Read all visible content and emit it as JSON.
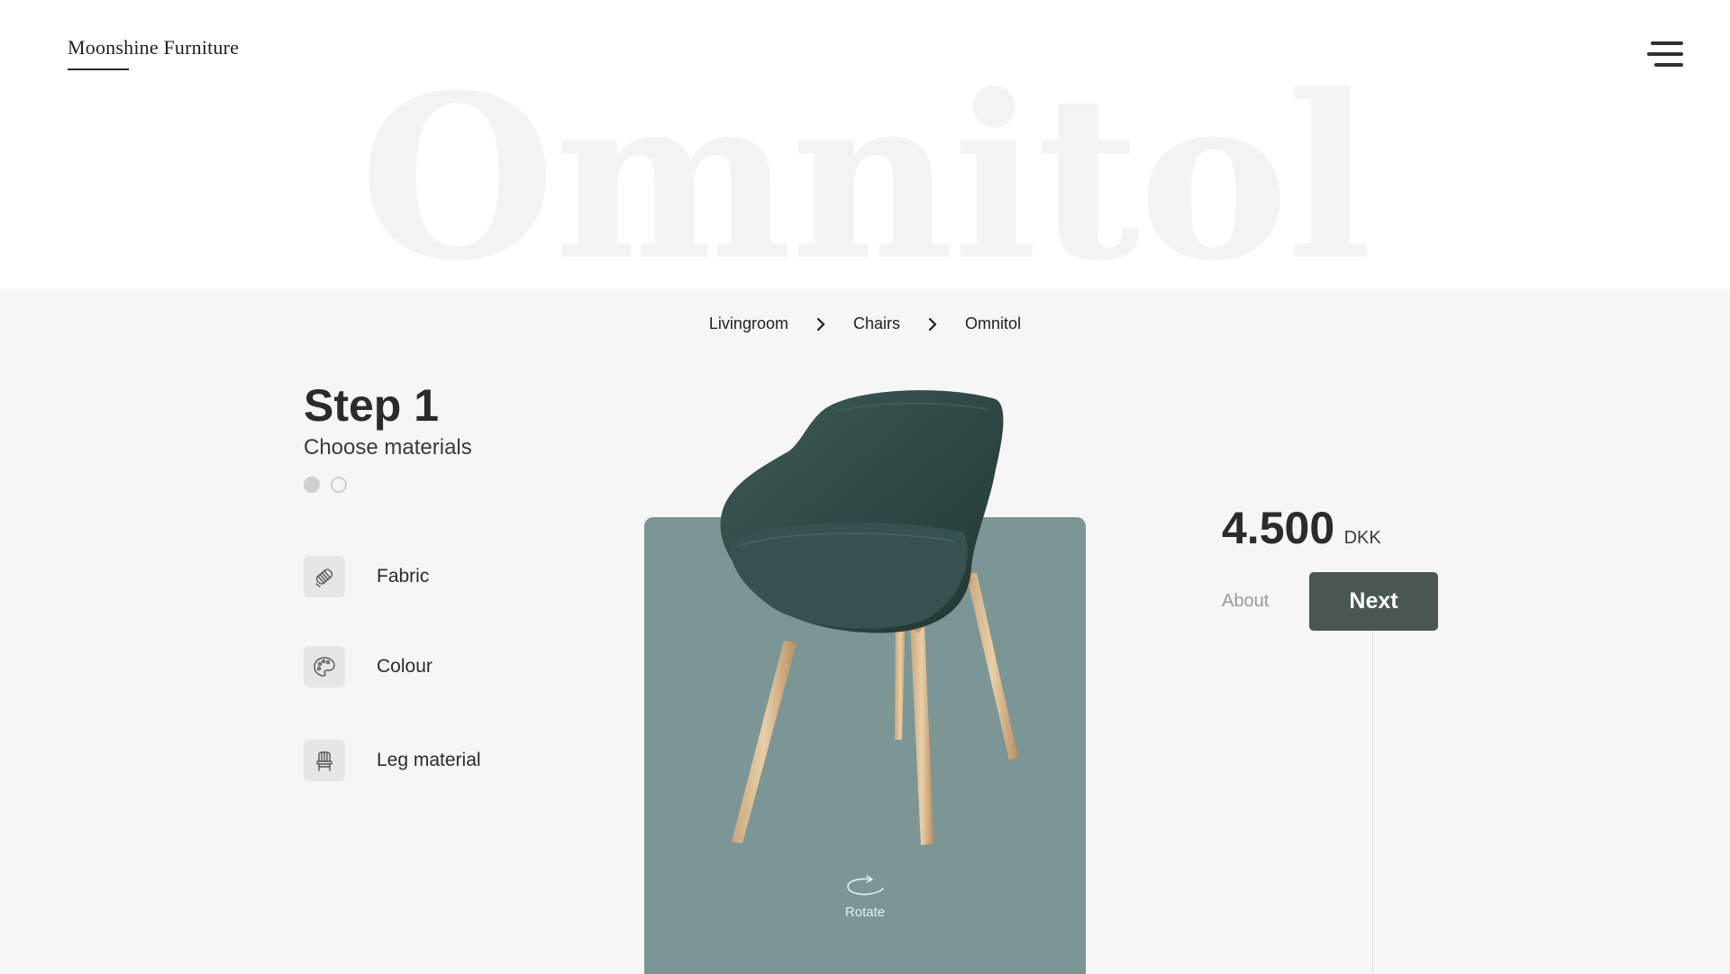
{
  "brand": {
    "name": "Moonshine Furniture"
  },
  "header": {
    "hero_word": "Omnitol"
  },
  "breadcrumb": {
    "items": [
      "Livingroom",
      "Chairs",
      "Omnitol"
    ]
  },
  "step": {
    "title": "Step 1",
    "subtitle": "Choose materials",
    "current": 1,
    "total": 2
  },
  "options": [
    {
      "label": "Fabric",
      "icon": "fabric-roll-icon"
    },
    {
      "label": "Colour",
      "icon": "palette-icon"
    },
    {
      "label": "Leg material",
      "icon": "chair-icon"
    }
  ],
  "product": {
    "image": "chair-image",
    "stage_color": "#7c9695",
    "rotate_label": "Rotate"
  },
  "price": {
    "value": "4.500",
    "currency": "DKK"
  },
  "actions": {
    "about": "About",
    "next": "Next"
  },
  "colors": {
    "accent": "#4a5655",
    "panel": "#f6f6f6"
  }
}
